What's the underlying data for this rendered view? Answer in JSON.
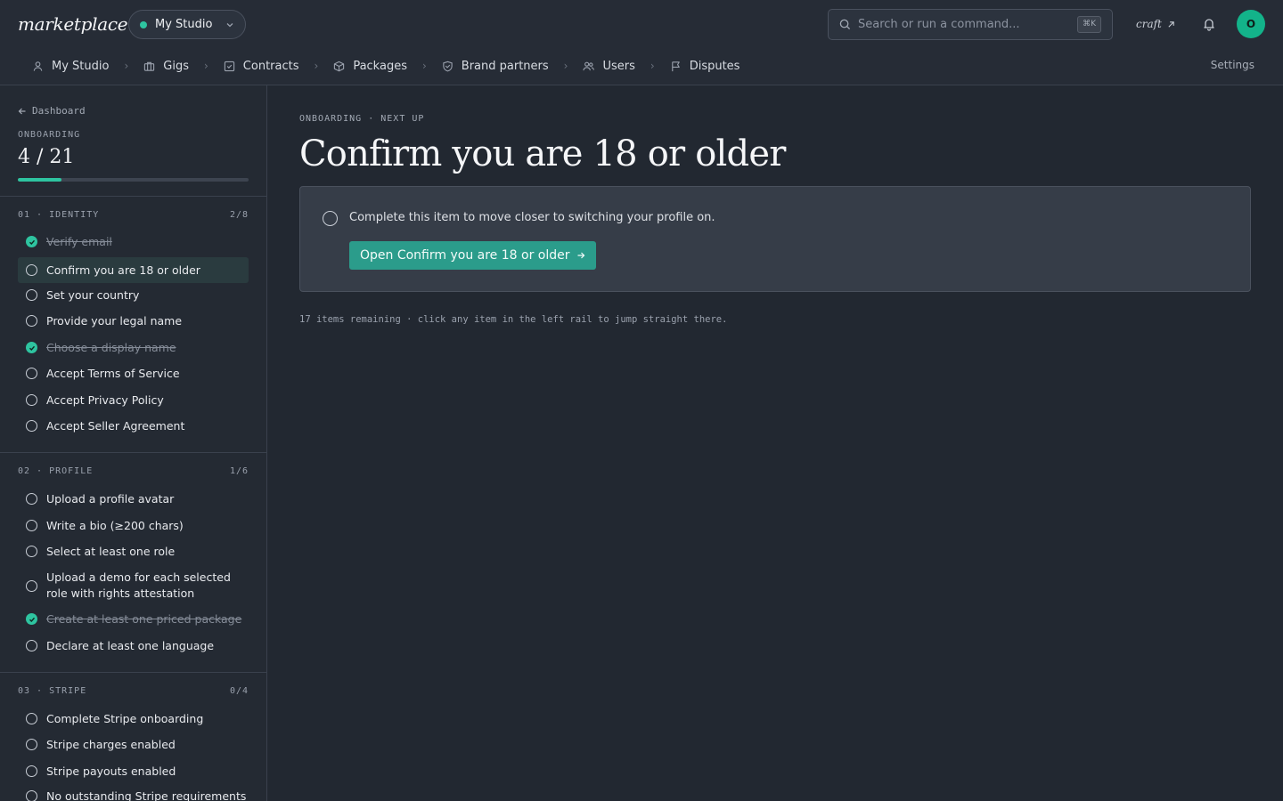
{
  "header": {
    "logo": "marketplace",
    "logo_dot": ".",
    "studio_switcher": "My Studio",
    "search_placeholder": "Search or run a command...",
    "search_shortcut": "⌘K",
    "craft_link": "craft",
    "avatar_initial": "O",
    "accent_color": "#2ec4a0"
  },
  "nav": {
    "items": [
      {
        "label": "My Studio",
        "icon": "user-icon"
      },
      {
        "label": "Gigs",
        "icon": "briefcase-icon"
      },
      {
        "label": "Contracts",
        "icon": "checkbox-icon"
      },
      {
        "label": "Packages",
        "icon": "package-icon"
      },
      {
        "label": "Brand partners",
        "icon": "badge-icon"
      },
      {
        "label": "Users",
        "icon": "users-icon"
      },
      {
        "label": "Disputes",
        "icon": "flag-icon"
      }
    ],
    "settings": "Settings"
  },
  "sidebar": {
    "back": "Dashboard",
    "onboarding_label": "ONBOARDING",
    "count": "4 / 21",
    "progress_fraction": 0.19,
    "sections": [
      {
        "title": "01 · IDENTITY",
        "count": "2/8",
        "items": [
          {
            "label": "Verify email",
            "done": true
          },
          {
            "label": "Confirm you are 18 or older",
            "done": false,
            "active": true
          },
          {
            "label": "Set your country",
            "done": false
          },
          {
            "label": "Provide your legal name",
            "done": false
          },
          {
            "label": "Choose a display name",
            "done": true
          },
          {
            "label": "Accept Terms of Service",
            "done": false
          },
          {
            "label": "Accept Privacy Policy",
            "done": false
          },
          {
            "label": "Accept Seller Agreement",
            "done": false
          }
        ]
      },
      {
        "title": "02 · PROFILE",
        "count": "1/6",
        "items": [
          {
            "label": "Upload a profile avatar",
            "done": false
          },
          {
            "label": "Write a bio (≥200 chars)",
            "done": false
          },
          {
            "label": "Select at least one role",
            "done": false
          },
          {
            "label": "Upload a demo for each selected role with rights attestation",
            "done": false
          },
          {
            "label": "Create at least one priced package",
            "done": true
          },
          {
            "label": "Declare at least one language",
            "done": false
          }
        ]
      },
      {
        "title": "03 · STRIPE",
        "count": "0/4",
        "items": [
          {
            "label": "Complete Stripe onboarding",
            "done": false
          },
          {
            "label": "Stripe charges enabled",
            "done": false
          },
          {
            "label": "Stripe payouts enabled",
            "done": false
          },
          {
            "label": "No outstanding Stripe requirements",
            "done": false
          }
        ]
      }
    ]
  },
  "main": {
    "eyebrow": "ONBOARDING · NEXT UP",
    "title": "Confirm you are 18 or older",
    "card_text": "Complete this item to move closer to switching your profile on.",
    "cta_label": "Open Confirm you are 18 or older",
    "footnote": "17 items remaining · click any item in the left rail to jump straight there."
  }
}
